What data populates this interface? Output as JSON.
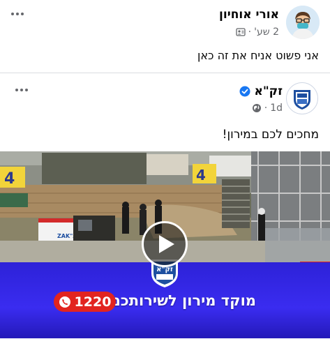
{
  "outer_post": {
    "author": "אורי אוחיון",
    "time": "2 שע'",
    "separator": "·",
    "privacy_icon": "friends-icon",
    "text": "אני פשוט אניח את זה כאן"
  },
  "shared_post": {
    "author": "זק\"א",
    "verified_icon": "verified-badge-icon",
    "time": "1d",
    "separator": "·",
    "privacy_icon": "globe-icon",
    "text": "מחכים לכם במירון!"
  },
  "video": {
    "banner_text": "מוקד מירון לשירותכם",
    "hotline": "1220",
    "logo_text": "זק\"א",
    "sign_left": "4",
    "sign_right": "4",
    "vehicle_label": "ZAK\"A",
    "colors": {
      "banner": "#3a2cf0",
      "hotline_pill": "#e2241f",
      "sign": "#f2d43a"
    }
  }
}
